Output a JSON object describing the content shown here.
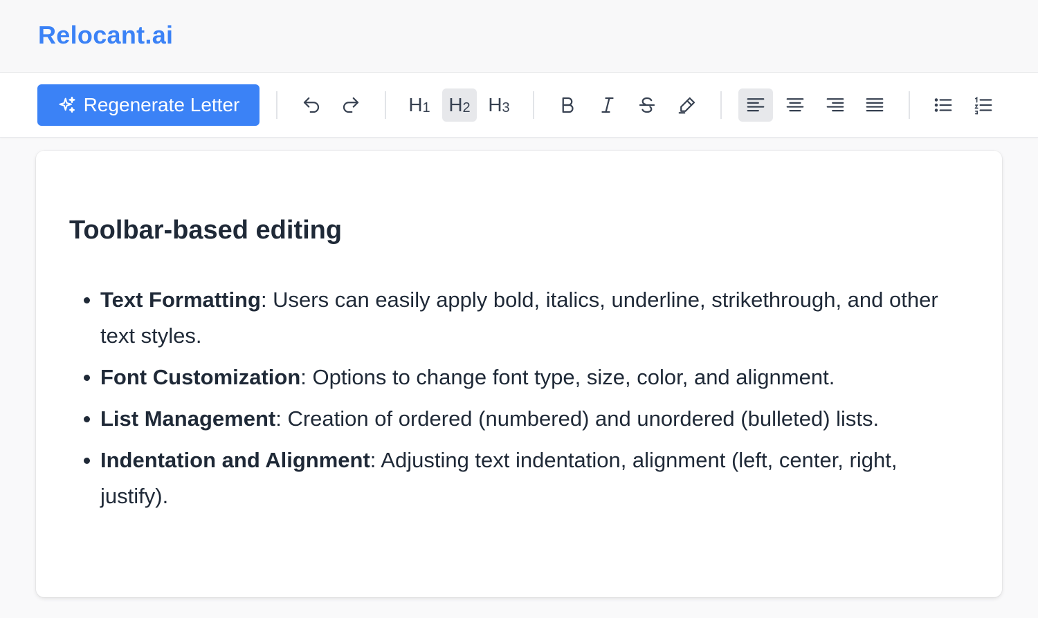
{
  "app": {
    "brand": "Relocant.ai"
  },
  "toolbar": {
    "regenerate_label": "Regenerate Letter",
    "headings": [
      {
        "main": "H",
        "sub": "1",
        "active": false
      },
      {
        "main": "H",
        "sub": "2",
        "active": true
      },
      {
        "main": "H",
        "sub": "3",
        "active": false
      }
    ],
    "active_align": "left",
    "accent_color": "#3b82f6"
  },
  "document": {
    "title": "Toolbar-based editing",
    "items": [
      {
        "label": "Text Formatting",
        "text": ": Users can easily apply bold, italics, underline, strikethrough, and other text styles."
      },
      {
        "label": "Font Customization",
        "text": ": Options to change font type, size, color, and alignment."
      },
      {
        "label": "List Management",
        "text": ": Creation of ordered (numbered) and unordered (bulleted) lists."
      },
      {
        "label": "Indentation and Alignment",
        "text": ": Adjusting text indentation, alignment (left, center, right, justify)."
      }
    ]
  }
}
